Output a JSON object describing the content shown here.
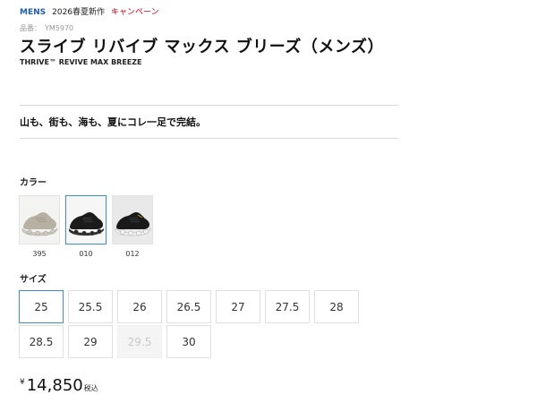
{
  "tags": {
    "gender": "MENS",
    "season": "2026春夏新作",
    "campaign": "キャンペーン"
  },
  "product": {
    "code_label": "品番：",
    "code": "YM5970",
    "title": "スライブ リバイブ マックス ブリーズ（メンズ）",
    "subtitle": "THRIVE™ REVIVE MAX BREEZE",
    "catchcopy": "山も、街も、海も、夏にコレ一足で完結。"
  },
  "color": {
    "label": "カラー",
    "swatches": [
      {
        "code": "395",
        "shoe_color": "#b7b1a4",
        "sole_color": "#cfc9bd",
        "selected": false
      },
      {
        "code": "010",
        "shoe_color": "#1c1c1c",
        "sole_color": "#2a2a2a",
        "selected": true
      },
      {
        "code": "012",
        "shoe_color": "#1a1a1a",
        "sole_color": "#f2f2f2",
        "selected": false
      }
    ]
  },
  "size": {
    "label": "サイズ",
    "options": [
      {
        "value": "25",
        "selected": true,
        "available": true
      },
      {
        "value": "25.5",
        "selected": false,
        "available": true
      },
      {
        "value": "26",
        "selected": false,
        "available": true
      },
      {
        "value": "26.5",
        "selected": false,
        "available": true
      },
      {
        "value": "27",
        "selected": false,
        "available": true
      },
      {
        "value": "27.5",
        "selected": false,
        "available": true
      },
      {
        "value": "28",
        "selected": false,
        "available": true
      },
      {
        "value": "28.5",
        "selected": false,
        "available": true
      },
      {
        "value": "29",
        "selected": false,
        "available": true
      },
      {
        "value": "29.5",
        "selected": false,
        "available": false
      },
      {
        "value": "30",
        "selected": false,
        "available": true
      }
    ]
  },
  "price": {
    "currency": "¥",
    "amount": "14,850",
    "tax_note": "税込"
  }
}
